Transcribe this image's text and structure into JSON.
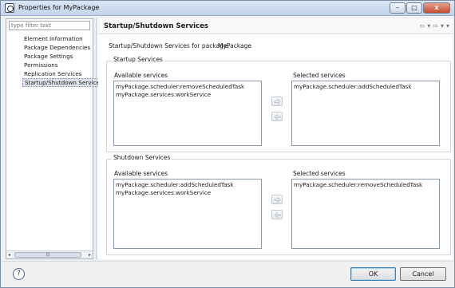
{
  "window": {
    "title": "Properties for MyPackage",
    "buttons": {
      "minimize": "–",
      "maximize": "□",
      "close": "x"
    }
  },
  "sidebar": {
    "filter_placeholder": "type filter text",
    "items": [
      {
        "label": "Element Information",
        "selected": false
      },
      {
        "label": "Package Dependencies",
        "selected": false
      },
      {
        "label": "Package Settings",
        "selected": false
      },
      {
        "label": "Permissions",
        "selected": false
      },
      {
        "label": "Replication Services",
        "selected": false
      },
      {
        "label": "Startup/Shutdown Services",
        "selected": true
      }
    ],
    "scrollbar": {
      "left": "◂",
      "right": "▸",
      "grip": "|||"
    }
  },
  "main": {
    "title": "Startup/Shutdown Services",
    "nav": {
      "back": "⇦",
      "back_menu": "▾",
      "forward": "⇨",
      "forward_menu": "▾",
      "view_menu": "▾"
    },
    "package_label": "Startup/Shutdown Services for package:",
    "package_name": "MyPackage",
    "startup": {
      "title": "Startup Services",
      "available_title": "Available services",
      "available": [
        "myPackage.scheduler:removeScheduledTask",
        "myPackage.services:workService"
      ],
      "selected_title": "Selected services",
      "selected": [
        "myPackage.scheduler:addScheduledTask"
      ]
    },
    "shutdown": {
      "title": "Shutdown Services",
      "available_title": "Available services",
      "available": [
        "myPackage.scheduler:addScheduledTask",
        "myPackage.services:workService"
      ],
      "selected_title": "Selected services",
      "selected": [
        "myPackage.scheduler:removeScheduledTask"
      ]
    }
  },
  "footer": {
    "help": "?",
    "ok": "OK",
    "cancel": "Cancel"
  },
  "colors": {
    "titlebar": "#c2d4ea",
    "close_button": "#c44a2e",
    "selection": "#dde3ec",
    "ok_border": "#3c7fb1"
  }
}
